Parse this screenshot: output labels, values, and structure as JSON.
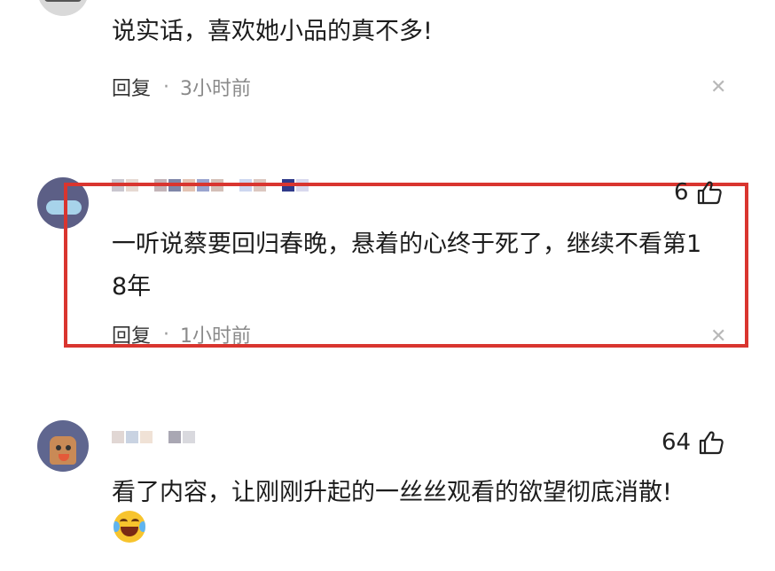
{
  "comments": [
    {
      "text": "说实话，喜欢她小品的真不多!",
      "reply_label": "回复",
      "separator": "·",
      "time": "3小时前"
    },
    {
      "text_line1": "一听说蔡要回归春晚，悬着的心终于死了，继续不看第1",
      "text_line2": "8年",
      "likes": "6",
      "reply_label": "回复",
      "separator": "·",
      "time": "1小时前"
    },
    {
      "text": "看了内容，让刚刚升起的一丝丝观看的欲望彻底消散!",
      "likes": "64",
      "emoji": "laughing-crying-emoji"
    }
  ],
  "icons": {
    "like": "thumbs-up-icon",
    "close": "close-icon"
  },
  "colors": {
    "highlight": "#d9352f",
    "meta_text": "#8a8a8a"
  }
}
